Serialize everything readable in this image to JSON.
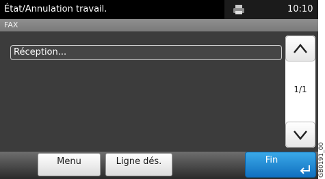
{
  "status_bar": {
    "title": "État/Annulation travail.",
    "clock": "10:10",
    "icon": "printer-icon"
  },
  "header": {
    "title": "FAX"
  },
  "list": {
    "items": [
      {
        "label": "Réception..."
      }
    ]
  },
  "pager": {
    "indicator": "1/1",
    "up_icon": "chevron-up-icon",
    "down_icon": "chevron-down-icon"
  },
  "bottom_bar": {
    "menu_label": "Menu",
    "line_label": "Ligne dés.",
    "end_label": "Fin",
    "end_icon": "enter-icon"
  },
  "caption": "GB0191_00",
  "colors": {
    "status_bg": "#000000",
    "content_bg": "#3c3c3c",
    "accent_blue": "#1e88d6"
  }
}
